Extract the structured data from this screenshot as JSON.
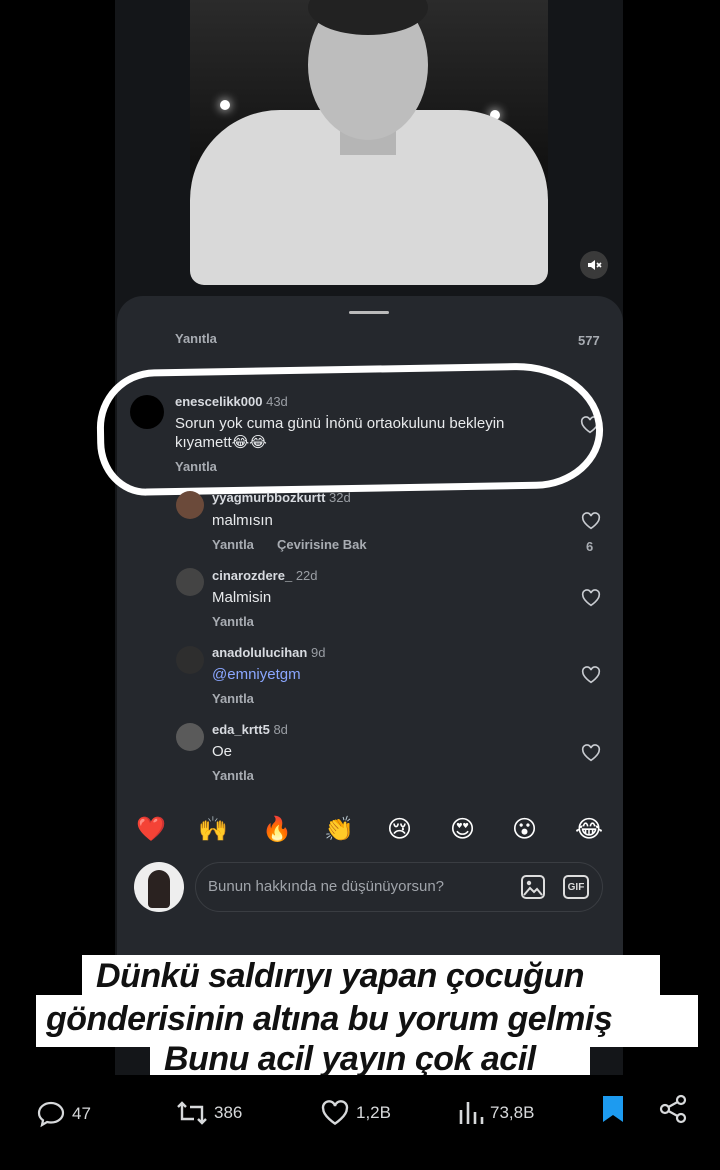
{
  "thread": {
    "reply_label": "Yanıtla",
    "reply_count": "577",
    "highlighted": {
      "username": "enescelikk000",
      "time": "43d",
      "text_line1": "Sorun yok cuma günü İnönü ortaokulunu bekleyin",
      "text_line2": "kıyamett😂😂",
      "reply": "Yanıtla"
    },
    "comments": [
      {
        "username": "yyagmurbbozkurtt",
        "time": "32d",
        "text": "malmısın",
        "reply": "Yanıtla",
        "translate": "Çevirisine Bak",
        "likes": "6"
      },
      {
        "username": "cinarozdere_",
        "time": "22d",
        "text": "Malmisin",
        "reply": "Yanıtla"
      },
      {
        "username": "anadolulucihan",
        "time": "9d",
        "text": "@emniyetgm",
        "reply": "Yanıtla"
      },
      {
        "username": "eda_krtt5",
        "time": "8d",
        "text": "Oe",
        "reply": "Yanıtla"
      }
    ]
  },
  "reactions": [
    "❤️",
    "🙌",
    "🔥",
    "👏",
    "😢",
    "😍",
    "😮",
    "😂"
  ],
  "composer": {
    "placeholder": "Bunun hakkında ne düşünüyorsun?",
    "gif_label": "GIF"
  },
  "caption": {
    "line1": "Dünkü saldırıyı yapan çocuğun",
    "line2": "gönderisinin altına bu yorum gelmiş",
    "line3": "Bunu acil yayın çok acil"
  },
  "tweet_stats": {
    "replies": "47",
    "retweets": "386",
    "likes": "1,2B",
    "views": "73,8B"
  },
  "colors": {
    "bookmark": "#1d9bf0",
    "sheet": "#25282d",
    "mention": "#8aa6ff"
  }
}
